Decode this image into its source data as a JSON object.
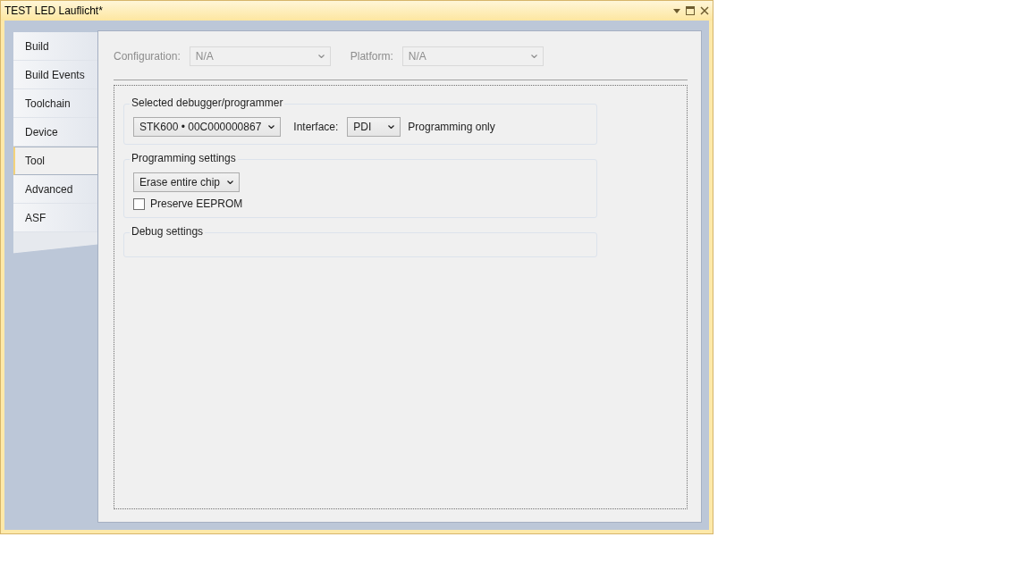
{
  "window": {
    "title": "TEST LED Lauflicht*"
  },
  "tabs": [
    {
      "label": "Build",
      "selected": false
    },
    {
      "label": "Build Events",
      "selected": false
    },
    {
      "label": "Toolchain",
      "selected": false
    },
    {
      "label": "Device",
      "selected": false
    },
    {
      "label": "Tool",
      "selected": true
    },
    {
      "label": "Advanced",
      "selected": false
    },
    {
      "label": "ASF",
      "selected": false
    }
  ],
  "header": {
    "configuration": {
      "label": "Configuration:",
      "value": "N/A",
      "disabled": true
    },
    "platform": {
      "label": "Platform:",
      "value": "N/A",
      "disabled": true
    }
  },
  "debugger_group": {
    "title": "Selected debugger/programmer",
    "tool": "STK600 • 00C000000867",
    "interface_label": "Interface:",
    "interface": "PDI",
    "mode": "Programming only"
  },
  "programming_group": {
    "title": "Programming settings",
    "erase": "Erase entire chip",
    "preserve_eeprom": {
      "label": "Preserve EEPROM",
      "checked": false
    }
  },
  "debug_group": {
    "title": "Debug settings"
  }
}
